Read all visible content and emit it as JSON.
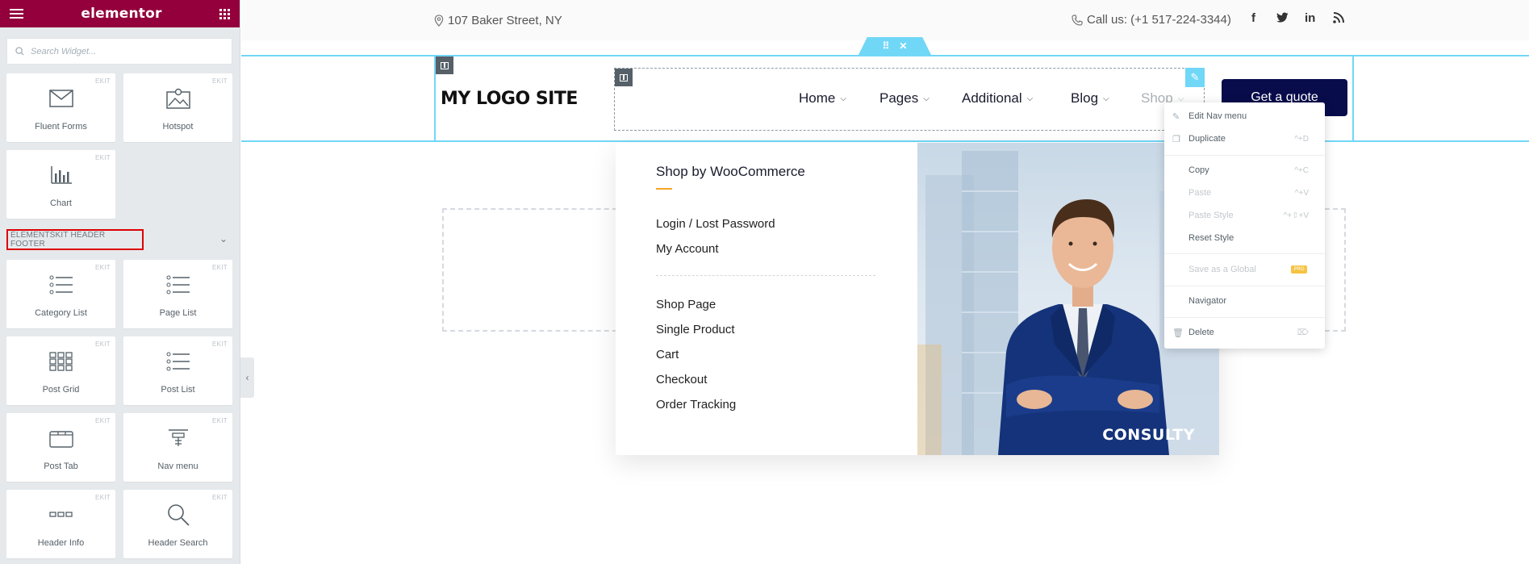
{
  "panel": {
    "title": "elementor",
    "search_placeholder": "Search Widget...",
    "badge": "EKIT",
    "section_label": "ELEMENTSKIT HEADER FOOTER",
    "widgets_top": [
      {
        "label": "Fluent Forms",
        "icon": "envelope-icon"
      },
      {
        "label": "Hotspot",
        "icon": "hotspot-image-icon"
      },
      {
        "label": "Chart",
        "icon": "bar-chart-icon"
      }
    ],
    "widgets_section": [
      {
        "label": "Category List",
        "icon": "list-icon"
      },
      {
        "label": "Page List",
        "icon": "list-icon"
      },
      {
        "label": "Post Grid",
        "icon": "grid-icon"
      },
      {
        "label": "Post List",
        "icon": "list-icon"
      },
      {
        "label": "Post Tab",
        "icon": "folder-tab-icon"
      },
      {
        "label": "Nav menu",
        "icon": "nav-menu-icon"
      },
      {
        "label": "Header Info",
        "icon": "dots-icon"
      },
      {
        "label": "Header Search",
        "icon": "search-icon"
      }
    ]
  },
  "topbar": {
    "address": "107 Baker Street, NY",
    "phone": "Call us: (+1 517-224-3344)",
    "social": [
      "f",
      "twitter",
      "in",
      "rss"
    ]
  },
  "header": {
    "logo": "MY LOGO SITE",
    "nav": [
      {
        "label": "Home"
      },
      {
        "label": "Pages"
      },
      {
        "label": "Additional"
      },
      {
        "label": "Blog"
      },
      {
        "label": "Shop"
      }
    ],
    "cta": "Get a quote"
  },
  "mega_menu": {
    "title": "Shop by WooCommerce",
    "group1": [
      "Login / Lost Password",
      "My Account"
    ],
    "group2": [
      "Shop Page",
      "Single Product",
      "Cart",
      "Checkout",
      "Order Tracking"
    ],
    "brand": "CONSULTY"
  },
  "context_menu": {
    "items": [
      {
        "label": "Edit Nav menu",
        "shortcut": "",
        "disabled": false
      },
      {
        "label": "Duplicate",
        "shortcut": "^+D",
        "disabled": false
      },
      {
        "label": "Copy",
        "shortcut": "^+C",
        "disabled": false
      },
      {
        "label": "Paste",
        "shortcut": "^+V",
        "disabled": true
      },
      {
        "label": "Paste Style",
        "shortcut": "^+⇧+V",
        "disabled": true
      },
      {
        "label": "Reset Style",
        "shortcut": "",
        "disabled": false
      },
      {
        "label": "Save as a Global",
        "shortcut": "",
        "disabled": true,
        "badge": "PRO"
      },
      {
        "label": "Navigator",
        "shortcut": "",
        "disabled": false
      },
      {
        "label": "Delete",
        "shortcut": "⌦",
        "disabled": false
      }
    ]
  },
  "colors": {
    "elementor_brand": "#93003c",
    "editor_accent": "#71d7f7",
    "cta_bg": "#080c4b",
    "highlight": "#dd0000",
    "underline": "#f5a623"
  }
}
